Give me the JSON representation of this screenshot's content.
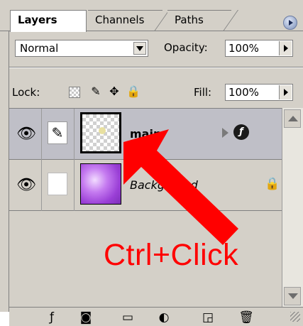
{
  "tabs": [
    {
      "label": "Layers",
      "active": true
    },
    {
      "label": "Channels",
      "active": false
    },
    {
      "label": "Paths",
      "active": false
    }
  ],
  "blend_mode": "Normal",
  "opacity": {
    "label": "Opacity:",
    "value": "100%"
  },
  "lock": {
    "label": "Lock:"
  },
  "fill": {
    "label": "Fill:",
    "value": "100%"
  },
  "layers": [
    {
      "name": "main",
      "selected": true,
      "thumbnail": "transparent-checker",
      "has_effects": true
    },
    {
      "name": "Background",
      "selected": false,
      "thumbnail": "purple-gradient",
      "locked": true
    }
  ],
  "annotation": {
    "text": "Ctrl+Click",
    "color": "#ff0000"
  },
  "toolbar_icons": [
    "add-style-icon",
    "add-mask-icon",
    "new-group-icon",
    "adjustment-layer-icon",
    "new-layer-icon",
    "delete-layer-icon"
  ],
  "colors": {
    "panel": "#d4d0c8",
    "selection": "#bfbfc7",
    "annotation": "#ff0000"
  }
}
